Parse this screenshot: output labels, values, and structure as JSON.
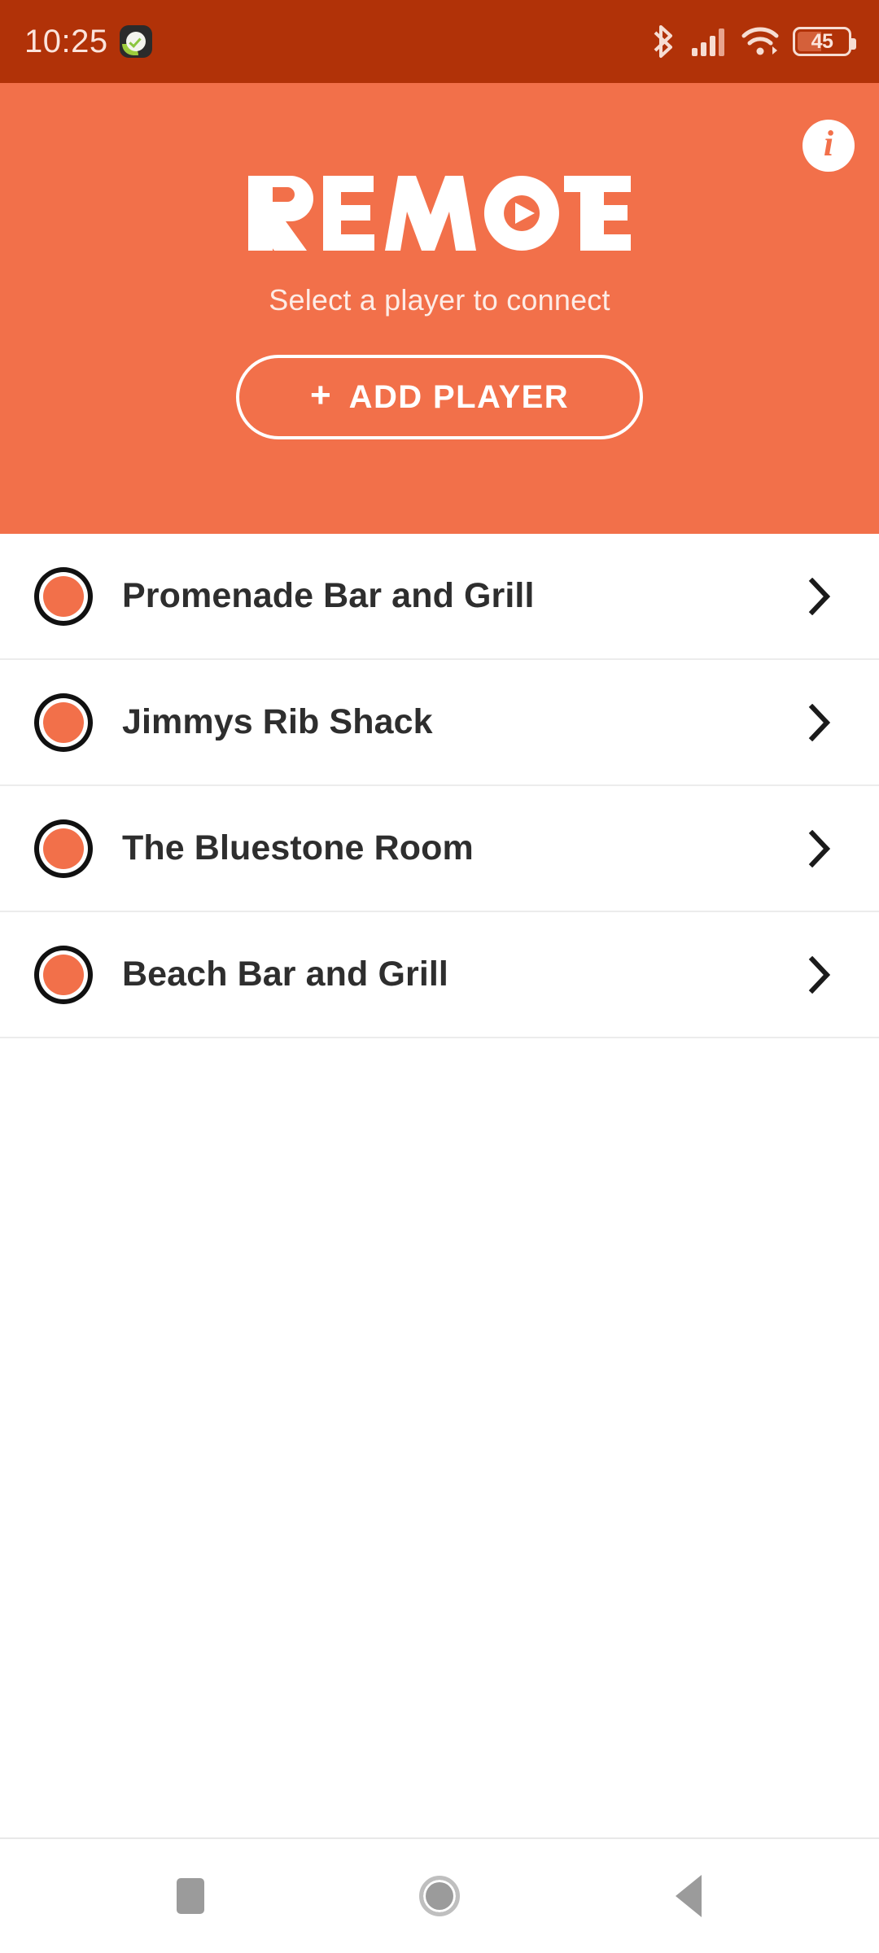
{
  "status_bar": {
    "time": "10:25",
    "notification_icon": "app-checkmark-icon",
    "bluetooth_icon": "bluetooth-icon",
    "signal_icon": "cellular-signal-icon",
    "wifi_icon": "wifi-icon",
    "battery_icon": "battery-icon",
    "battery_percent": "45",
    "background_color": "#b13208"
  },
  "header": {
    "logo_text": "REMOTE",
    "logo_play_icon": "play-triangle-icon",
    "tagline": "Select a player to connect",
    "info_icon": "info-icon",
    "info_glyph": "i",
    "add_player": {
      "plus": "+",
      "label": "ADD PLAYER"
    },
    "background_color": "#f2704a"
  },
  "players": [
    {
      "name": "Promenade Bar and Grill",
      "status_icon": "player-status-dot",
      "chevron_icon": "chevron-right-icon"
    },
    {
      "name": "Jimmys Rib Shack",
      "status_icon": "player-status-dot",
      "chevron_icon": "chevron-right-icon"
    },
    {
      "name": "The Bluestone Room",
      "status_icon": "player-status-dot",
      "chevron_icon": "chevron-right-icon"
    },
    {
      "name": "Beach Bar and Grill",
      "status_icon": "player-status-dot",
      "chevron_icon": "chevron-right-icon"
    }
  ],
  "nav_bar": {
    "recents_icon": "recents-square-icon",
    "home_icon": "home-circle-icon",
    "back_icon": "back-triangle-icon"
  },
  "colors": {
    "brand_orange": "#f2704a",
    "status_bar": "#b13208",
    "text_dark": "#2e2e2e",
    "nav_gray": "#9b9b9b"
  }
}
